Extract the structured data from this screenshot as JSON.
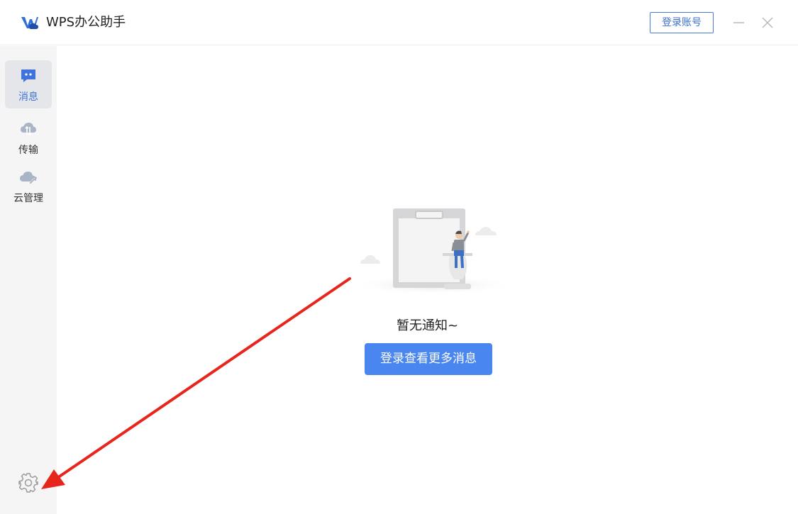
{
  "app": {
    "title": "WPS办公助手",
    "logo_icon": "wps-logo-icon",
    "accent_color": "#4a86f0"
  },
  "titlebar": {
    "login_account_label": "登录账号",
    "minimize_icon": "minimize-icon",
    "close_icon": "close-icon"
  },
  "sidebar": {
    "items": [
      {
        "label": "消息",
        "icon": "message-bubble-icon",
        "active": true
      },
      {
        "label": "传输",
        "icon": "cloud-transfer-icon",
        "active": false
      },
      {
        "label": "云管理",
        "icon": "cloud-manage-icon",
        "active": false
      }
    ],
    "settings_icon": "gear-icon"
  },
  "main": {
    "empty_text": "暂无通知~",
    "login_more_label": "登录查看更多消息",
    "illustration": "empty-notifications-illustration"
  },
  "annotation": {
    "color": "#e8251c",
    "icon": "red-arrow-pointing-to-settings"
  }
}
